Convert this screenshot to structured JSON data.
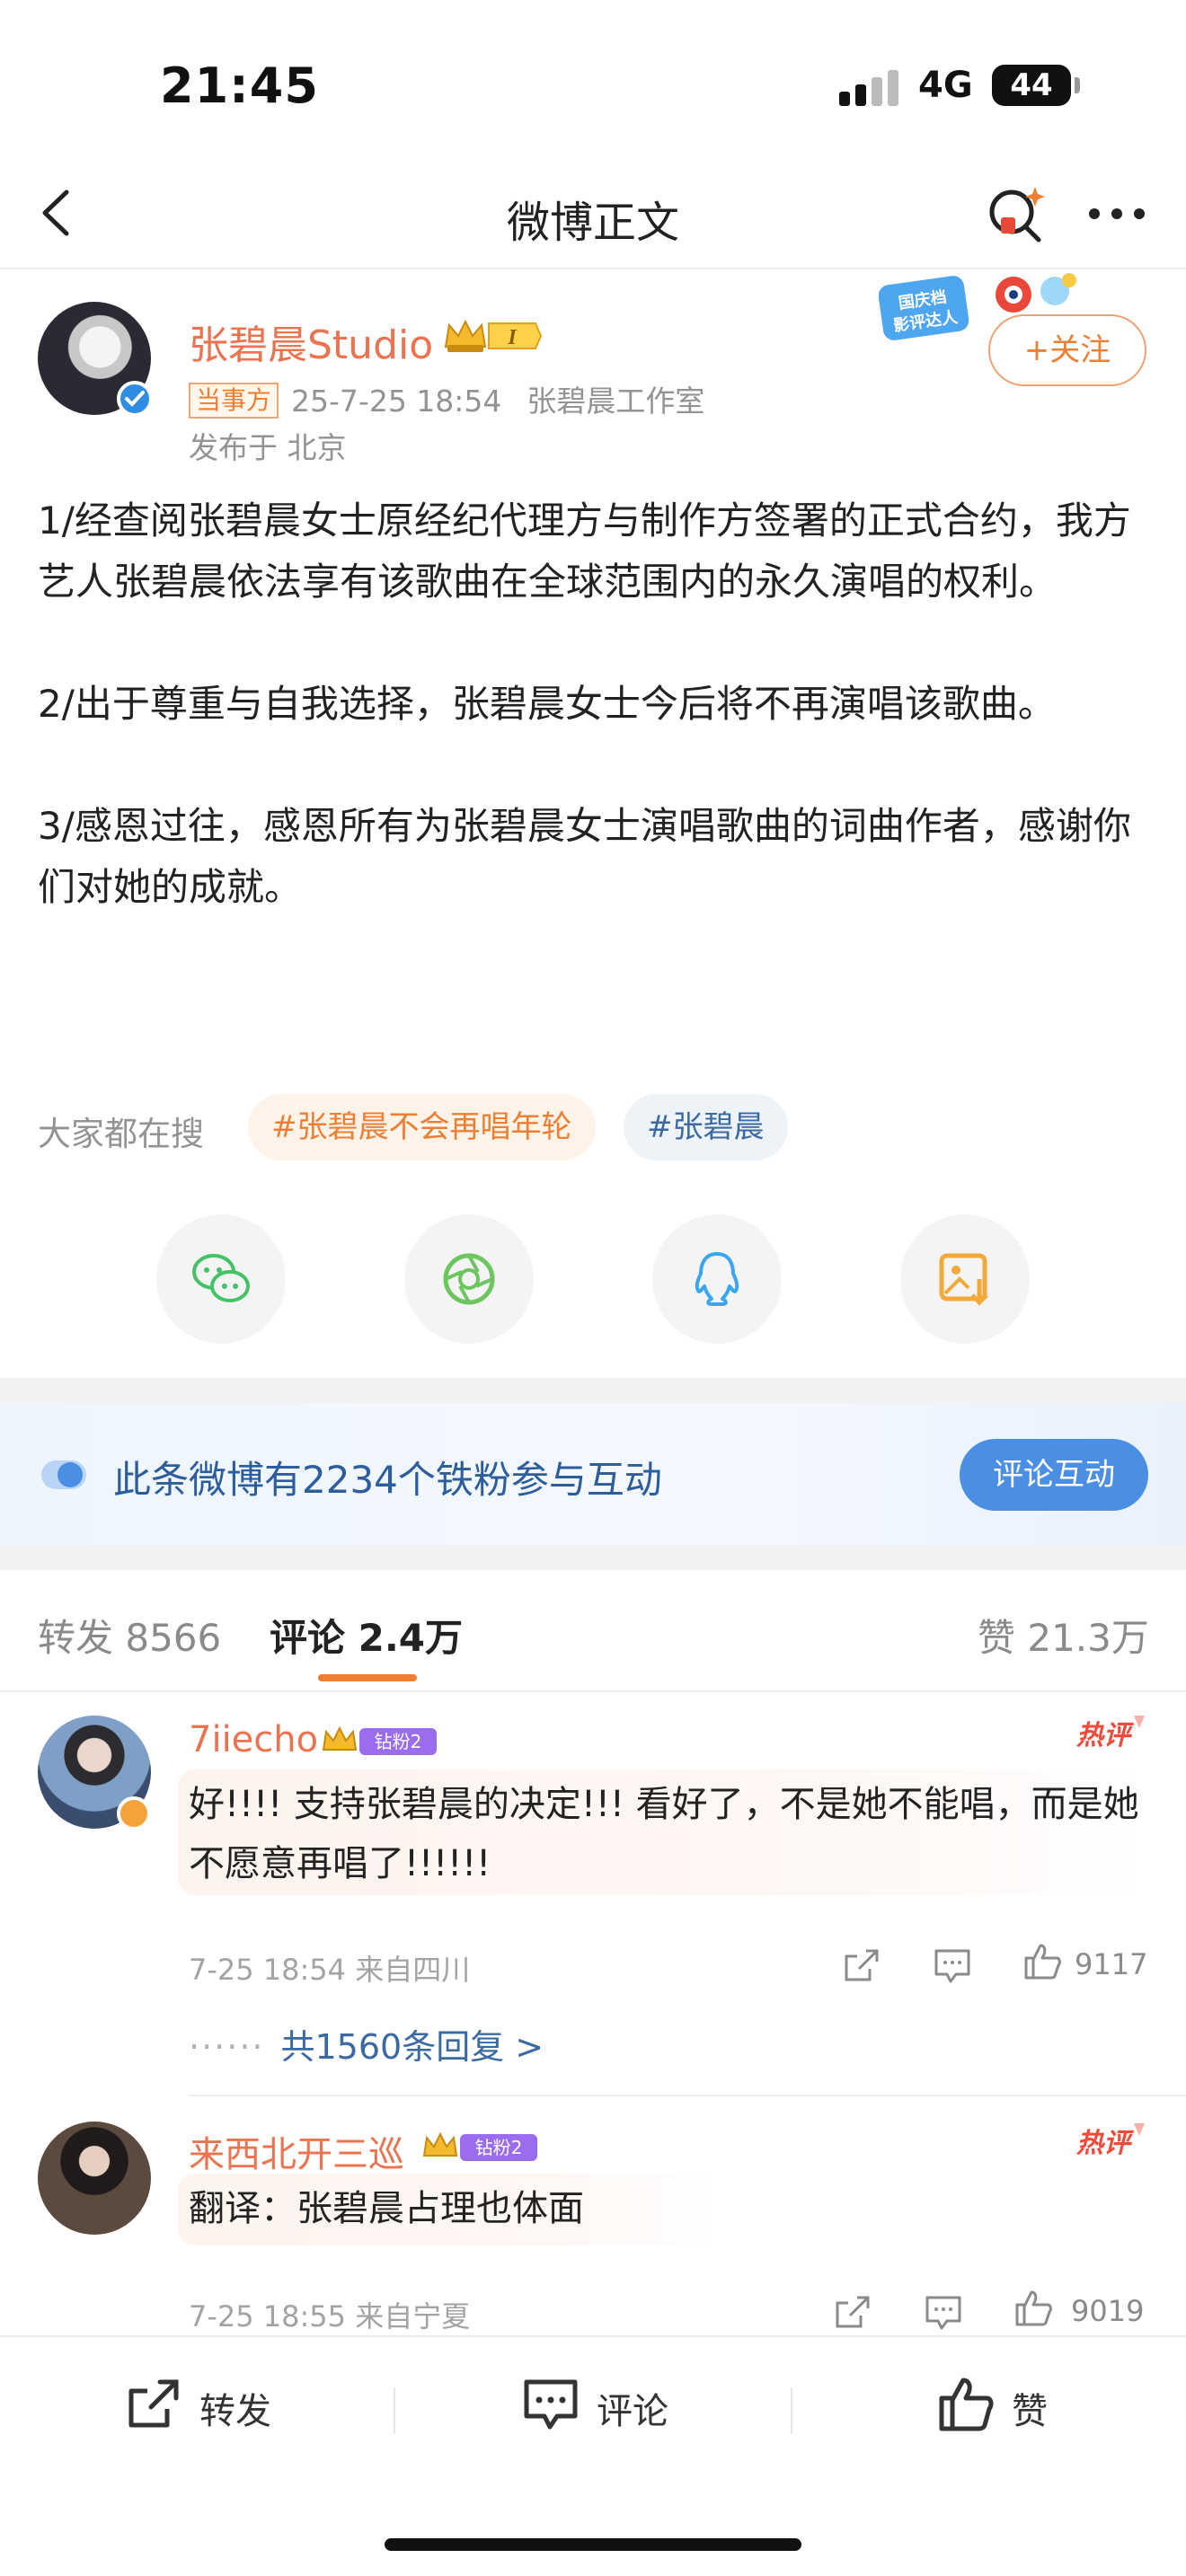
{
  "status_bar": {
    "time": "21:45",
    "network": "4G",
    "battery": "44"
  },
  "nav": {
    "title": "微博正文",
    "back_icon": "chevron-left-icon",
    "search_icon": "search-spark-icon",
    "more_icon": "more-dots-icon"
  },
  "author": {
    "name": "张碧晨Studio",
    "tag": "当事方",
    "time": "25-7-25 18:54",
    "source": "张碧晨工作室",
    "location": "发布于 北京",
    "follow_label": "+关注",
    "event_badge": "国庆档影评达人"
  },
  "post": {
    "paragraphs": [
      "1/经查阅张碧晨女士原经纪代理方与制作方签署的正式合约，我方艺人张碧晨依法享有该歌曲在全球范围内的永久演唱的权利。",
      "2/出于尊重与自我选择，张碧晨女士今后将不再演唱该歌曲。",
      "3/感恩过往，感恩所有为张碧晨女士演唱歌曲的词曲作者，感谢你们对她的成就。"
    ]
  },
  "search": {
    "label": "大家都在搜",
    "tags": [
      "#张碧晨不会再唱年轮",
      "#张碧晨"
    ]
  },
  "share": [
    "wechat-icon",
    "moments-icon",
    "qq-icon",
    "save-image-icon"
  ],
  "fans_banner": {
    "text": "此条微博有2234个铁粉参与互动",
    "button": "评论互动"
  },
  "tabs": {
    "repost": "转发 8566",
    "comment": "评论 2.4万",
    "like": "赞 21.3万"
  },
  "comments": [
    {
      "user": "7iiecho",
      "fan_badge": "钻粉2",
      "hot": "热评",
      "text": "好!!!! 支持张碧晨的决定!!! 看好了，不是她不能唱，而是她不愿意再唱了!!!!!!",
      "meta": "7-25 18:54  来自四川",
      "likes": "9117",
      "replies": "共1560条回复 >"
    },
    {
      "user": "来西北开三巡",
      "fan_badge": "钻粉2",
      "hot": "热评",
      "text": "翻译：张碧晨占理也体面",
      "meta": "7-25 18:55  来自宁夏",
      "likes": "9019"
    }
  ],
  "toolbar": {
    "repost": "转发",
    "comment": "评论",
    "like": "赞"
  },
  "colors": {
    "accent": "#ee7f32",
    "name": "#eb7350",
    "link": "#3b6aa3",
    "fans_button": "#4a8fe3"
  }
}
